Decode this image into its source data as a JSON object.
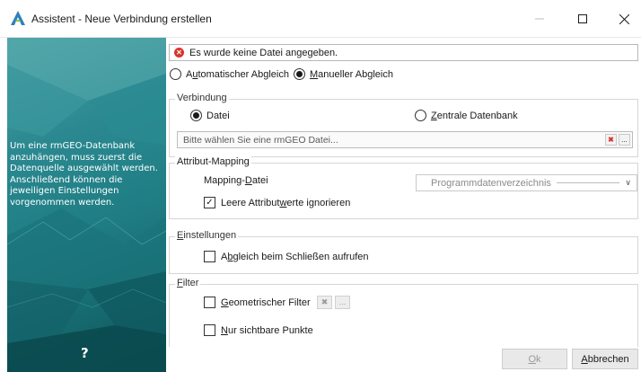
{
  "window": {
    "title": "Assistent - Neue Verbindung erstellen",
    "icon": "rmgeo-logo-icon",
    "minimize_icon": "minimize-icon",
    "maximize_icon": "maximize-icon",
    "close_icon": "close-icon"
  },
  "side_panel": {
    "text": "Um eine rmGEO-Datenbank anzuhängen, muss zuerst die Datenquelle ausgewählt werden. Anschließend können die jeweiligen Einstellungen vorgenommen werden.",
    "help": "?"
  },
  "error": {
    "icon": "error-icon",
    "message": "Es wurde keine Datei angegeben."
  },
  "sync_mode": {
    "automatic": {
      "prefix": "A",
      "underlined": "u",
      "suffix": "tomatischer Abgleich",
      "selected": false
    },
    "manual": {
      "prefix": "",
      "underlined": "M",
      "suffix": "anueller Abgleich",
      "selected": true
    }
  },
  "connection": {
    "title": "Verbindung",
    "file": {
      "label": "Datei",
      "selected": true
    },
    "central_db": {
      "prefix": "",
      "underlined": "Z",
      "suffix": "entrale Datenbank",
      "selected": false
    },
    "file_placeholder": "Bitte wählen Sie eine rmGEO Datei...",
    "clear_icon": "clear-icon",
    "browse_label": "..."
  },
  "attribute_mapping": {
    "title": "Attribut-Mapping",
    "mapping_prefix": "Mapping-",
    "mapping_underlined": "D",
    "mapping_suffix": "atei",
    "dropdown_value": "Programmdatenverzeichnis",
    "ignore_empty": {
      "prefix": "Leere Attribut",
      "underlined": "w",
      "suffix": "erte ignorieren",
      "checked": true
    }
  },
  "settings": {
    "title_underlined": "E",
    "title_rest": "instellungen",
    "sync_on_close": {
      "prefix": "A",
      "underlined": "b",
      "suffix": "gleich beim Schließen aufrufen",
      "checked": false
    }
  },
  "filter": {
    "title_underlined": "F",
    "title_rest": "ilter",
    "geometric": {
      "prefix": "",
      "underlined": "G",
      "suffix": "eometrischer Filter",
      "checked": false
    },
    "geo_clear_icon": "clear-icon",
    "geo_browse_label": "...",
    "visible_only": {
      "prefix": "",
      "underlined": "N",
      "suffix": "ur sichtbare Punkte",
      "checked": false
    }
  },
  "buttons": {
    "ok": {
      "underlined": "O",
      "rest": "k"
    },
    "cancel": {
      "underlined": "A",
      "rest": "bbrechen"
    }
  }
}
